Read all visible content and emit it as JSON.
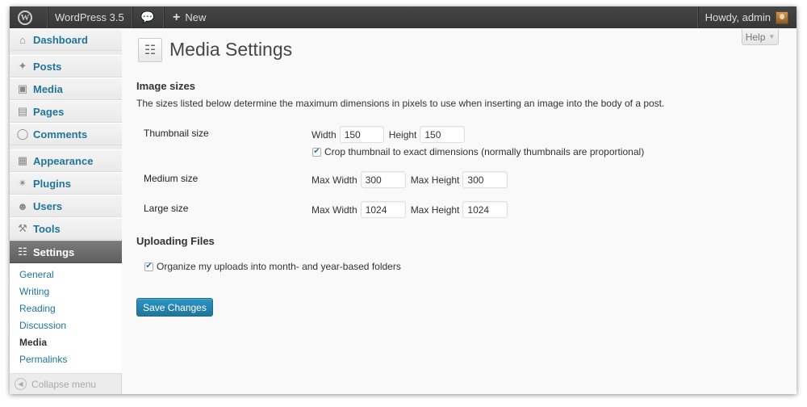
{
  "adminbar": {
    "site_name": "WordPress 3.5",
    "new_label": "New",
    "howdy": "Howdy, admin"
  },
  "sidebar": {
    "items": [
      {
        "label": "Dashboard",
        "icon": "dashboard-icon"
      },
      {
        "label": "Posts",
        "icon": "pushpin-icon"
      },
      {
        "label": "Media",
        "icon": "media-icon"
      },
      {
        "label": "Pages",
        "icon": "pages-icon"
      },
      {
        "label": "Comments",
        "icon": "comment-icon"
      },
      {
        "label": "Appearance",
        "icon": "appearance-icon"
      },
      {
        "label": "Plugins",
        "icon": "plugin-icon"
      },
      {
        "label": "Users",
        "icon": "users-icon"
      },
      {
        "label": "Tools",
        "icon": "tools-icon"
      },
      {
        "label": "Settings",
        "icon": "settings-icon"
      }
    ],
    "submenu": [
      "General",
      "Writing",
      "Reading",
      "Discussion",
      "Media",
      "Permalinks"
    ],
    "collapse_label": "Collapse menu"
  },
  "help": {
    "label": "Help"
  },
  "page": {
    "title": "Media Settings",
    "image_sizes_heading": "Image sizes",
    "description": "The sizes listed below determine the maximum dimensions in pixels to use when inserting an image into the body of a post.",
    "thumbnail": {
      "label": "Thumbnail size",
      "width_label": "Width",
      "width": "150",
      "height_label": "Height",
      "height": "150",
      "crop_label": "Crop thumbnail to exact dimensions (normally thumbnails are proportional)",
      "crop_checked": true
    },
    "medium": {
      "label": "Medium size",
      "width_label": "Max Width",
      "width": "300",
      "height_label": "Max Height",
      "height": "300"
    },
    "large": {
      "label": "Large size",
      "width_label": "Max Width",
      "width": "1024",
      "height_label": "Max Height",
      "height": "1024"
    },
    "uploading_heading": "Uploading Files",
    "organize_label": "Organize my uploads into month- and year-based folders",
    "organize_checked": true,
    "save_label": "Save Changes"
  },
  "colors": {
    "link": "#21759b",
    "adminbar": "#464646",
    "button": "#21759b"
  }
}
